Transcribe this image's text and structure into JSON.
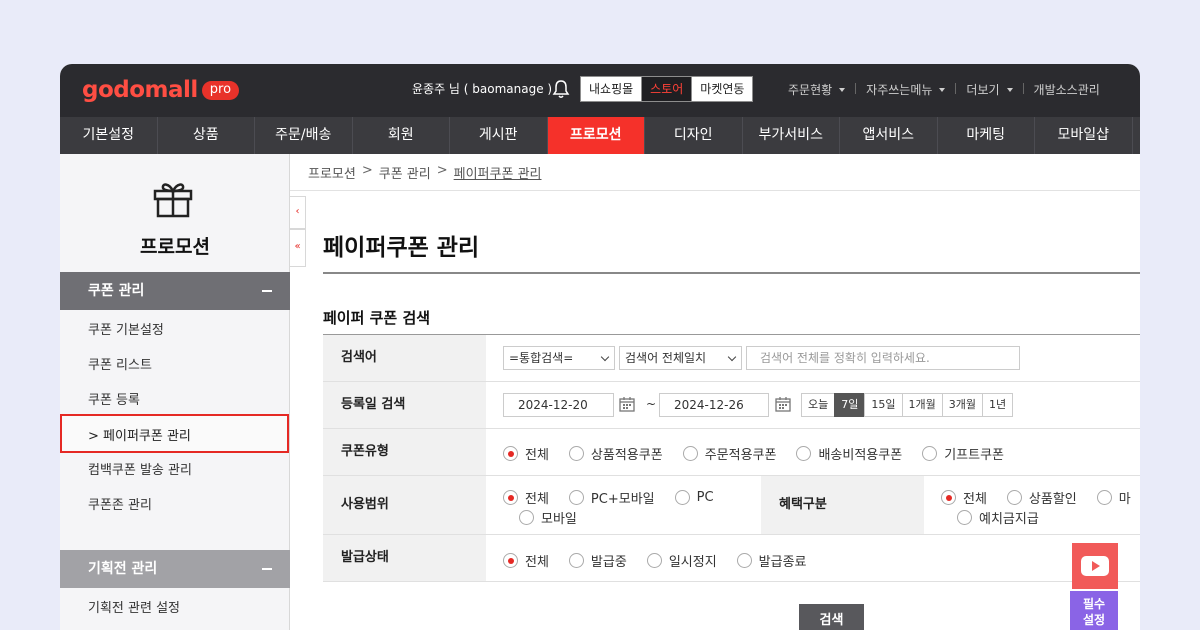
{
  "header": {
    "logo": "godomall",
    "logo_badge": "pro",
    "user": "윤종주 님 ( baomanage )",
    "buttons": [
      "내쇼핑몰",
      "스토어",
      "마켓연동"
    ],
    "active_button": "스토어",
    "links": [
      "주문현황",
      "자주쓰는메뉴",
      "더보기",
      "개발소스관리"
    ]
  },
  "nav": {
    "items": [
      "기본설정",
      "상품",
      "주문/배송",
      "회원",
      "게시판",
      "프로모션",
      "디자인",
      "부가서비스",
      "앱서비스",
      "마케팅",
      "모바일샵"
    ],
    "active": "프로모션"
  },
  "sidebar": {
    "title": "프로모션",
    "section1": "쿠폰 관리",
    "items1": [
      "쿠폰 기본설정",
      "쿠폰 리스트",
      "쿠폰 등록",
      "페이퍼쿠폰 관리",
      "컴백쿠폰 발송 관리",
      "쿠폰존 관리"
    ],
    "active_item": "> 페이퍼쿠폰 관리",
    "section2": "기획전 관리",
    "items2": [
      "기획전 관련 설정"
    ]
  },
  "breadcrumb": [
    "프로모션",
    "쿠폰 관리",
    "페이퍼쿠폰 관리"
  ],
  "breadcrumb_sep": ">",
  "collapse_icons": [
    "‹",
    "«"
  ],
  "page_title": "페이퍼쿠폰 관리",
  "section_title": "페이퍼 쿠폰 검색",
  "search": {
    "label": "검색어",
    "scope_select": "=통합검색=",
    "match_select": "검색어 전체일치",
    "placeholder": "검색어 전체를 정확히 입력하세요."
  },
  "date": {
    "label": "등록일 검색",
    "start": "2024-12-20",
    "end": "2024-12-26",
    "separator": "~",
    "periods": [
      "오늘",
      "7일",
      "15일",
      "1개월",
      "3개월",
      "1년"
    ],
    "active_period": "7일"
  },
  "coupon_type": {
    "label": "쿠폰유형",
    "options": [
      "전체",
      "상품적용쿠폰",
      "주문적용쿠폰",
      "배송비적용쿠폰",
      "기프트쿠폰"
    ],
    "selected": "전체"
  },
  "usage_scope": {
    "label": "사용범위",
    "options": [
      "전체",
      "PC+모바일",
      "PC",
      "모바일"
    ],
    "selected": "전체"
  },
  "benefit": {
    "label": "혜택구분",
    "options": [
      "전체",
      "상품할인",
      "마",
      "예치금지급"
    ],
    "selected": "전체"
  },
  "issue_status": {
    "label": "발급상태",
    "options": [
      "전체",
      "발급중",
      "일시정지",
      "발급종료"
    ],
    "selected": "전체"
  },
  "search_button": "검색",
  "floating": {
    "must_setting": [
      "필수",
      "설정"
    ]
  },
  "colors": {
    "accent": "#f5312a",
    "background": "#e9ebf9",
    "topbar": "#2b2b2f",
    "nav": "#3b3b3f"
  }
}
